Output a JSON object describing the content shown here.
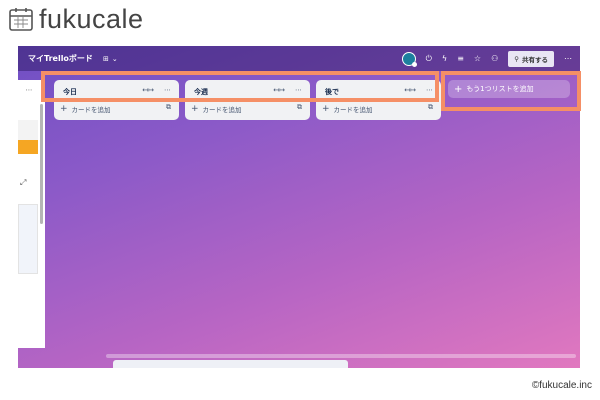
{
  "brand": {
    "name": "fukucale"
  },
  "board": {
    "title": "マイTrelloボード",
    "view_icon": "view-icon",
    "share_label": "共有する"
  },
  "header_icons": [
    "avatar",
    "power-up-icon",
    "automation-icon",
    "filter-icon",
    "star-icon",
    "members-icon",
    "more-icon"
  ],
  "lists": [
    {
      "title": "今日",
      "add_card_label": "カードを追加"
    },
    {
      "title": "今週",
      "add_card_label": "カードを追加"
    },
    {
      "title": "後で",
      "add_card_label": "カードを追加"
    }
  ],
  "add_list": {
    "label": "もう1つリストを追加"
  },
  "colors": {
    "highlight": "#f58f66",
    "orange_label": "#f5a623"
  },
  "copyright": "©fukucale.inc"
}
